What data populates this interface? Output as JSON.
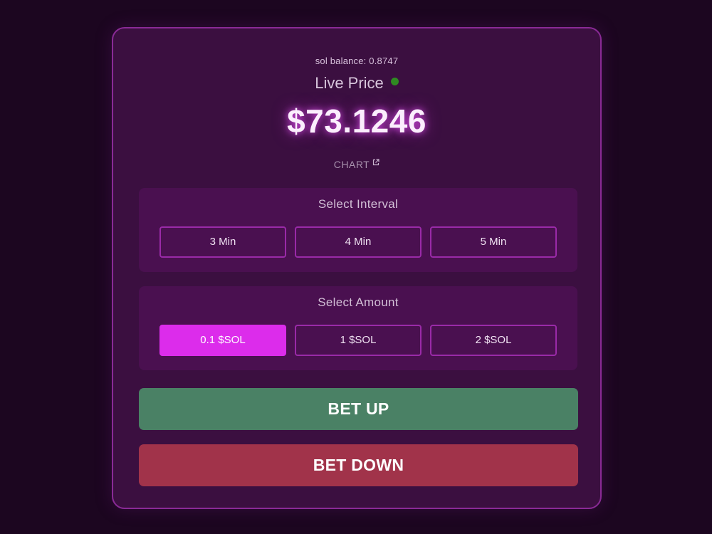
{
  "wallet": {
    "balance_text": "sol balance: 0.8747"
  },
  "price": {
    "live_label": "Live Price",
    "value": "$73.1246",
    "status_color": "#2f8a22",
    "chart_label": "CHART",
    "chart_icon": "external-link-icon"
  },
  "interval": {
    "title": "Select Interval",
    "options": [
      "3 Min",
      "4 Min",
      "5 Min"
    ],
    "selected": null
  },
  "amount": {
    "title": "Select Amount",
    "options": [
      "0.1 $SOL",
      "1 $SOL",
      "2 $SOL"
    ],
    "selected": "0.1 $SOL"
  },
  "actions": {
    "bet_up": "BET UP",
    "bet_down": "BET DOWN"
  },
  "colors": {
    "background": "#1c0620",
    "card": "#3b0f40",
    "accent": "#dc2ceb",
    "bet_up": "#4a8165",
    "bet_down": "#a1334a"
  }
}
